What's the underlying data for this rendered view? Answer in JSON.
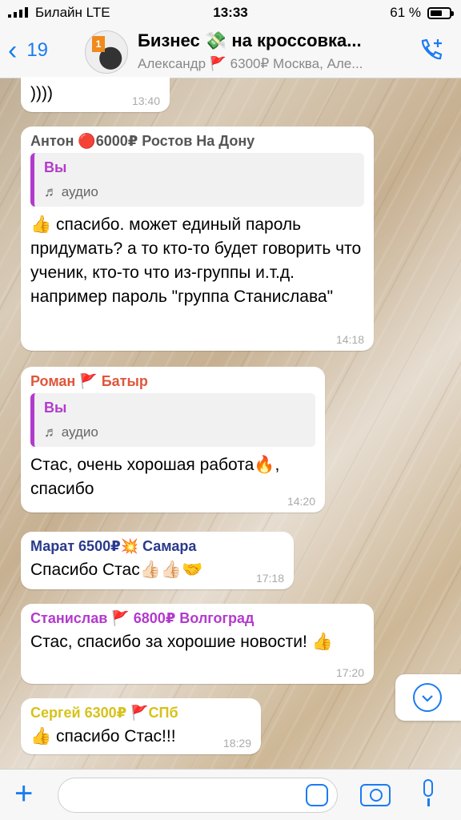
{
  "status_bar": {
    "carrier": "Билайн  LTE",
    "time": "13:33",
    "battery": "61 %"
  },
  "header": {
    "back_count": "19",
    "title": "Бизнес 💸 на кроссовка...",
    "subtitle": "Александр 🚩 6300₽ Москва, Але..."
  },
  "messages": [
    {
      "sender": "",
      "text": "))))",
      "time": "13:40"
    },
    {
      "sender": "Антон 🔴6000₽ Ростов На Дону",
      "sender_color": "#555555",
      "quote_author": "Вы",
      "quote_text": "♬ аудио",
      "text": "👍 спасибо. может единый пароль придумать? а то кто-то будет говорить что ученик, кто-то что из-группы и.т.д. например пароль \"группа Станислава\"",
      "time": "14:18"
    },
    {
      "sender": "Роман 🚩 Батыр",
      "sender_color": "#e0563b",
      "quote_author": "Вы",
      "quote_text": "♬ аудио",
      "text": "Стас, очень хорошая работа🔥, спасибо",
      "time": "14:20"
    },
    {
      "sender": "Марат 6500₽💥 Самара",
      "sender_color": "#2a3a8c",
      "text": "Спасибо Стас👍🏻👍🏻🤝",
      "time": "17:18"
    },
    {
      "sender": "Станислав 🚩 6800₽ Волгоград",
      "sender_color": "#b23acd",
      "text": "Стас, спасибо за хорошие новости! 👍",
      "time": "17:20"
    },
    {
      "sender": "Сергей 6300₽ 🚩СПб",
      "sender_color": "#d6c21a",
      "text": "👍 спасибо Стас!!!",
      "time": "18:29"
    }
  ],
  "composer": {
    "placeholder": ""
  },
  "colors": {
    "accent": "#1a7cf2",
    "quote_bar": "#b23acd"
  },
  "icons": [
    "signal-icon",
    "battery-icon",
    "back-chevron-icon",
    "add-call-icon",
    "scroll-down-icon",
    "plus-icon",
    "sticker-icon",
    "camera-icon",
    "mic-icon"
  ]
}
